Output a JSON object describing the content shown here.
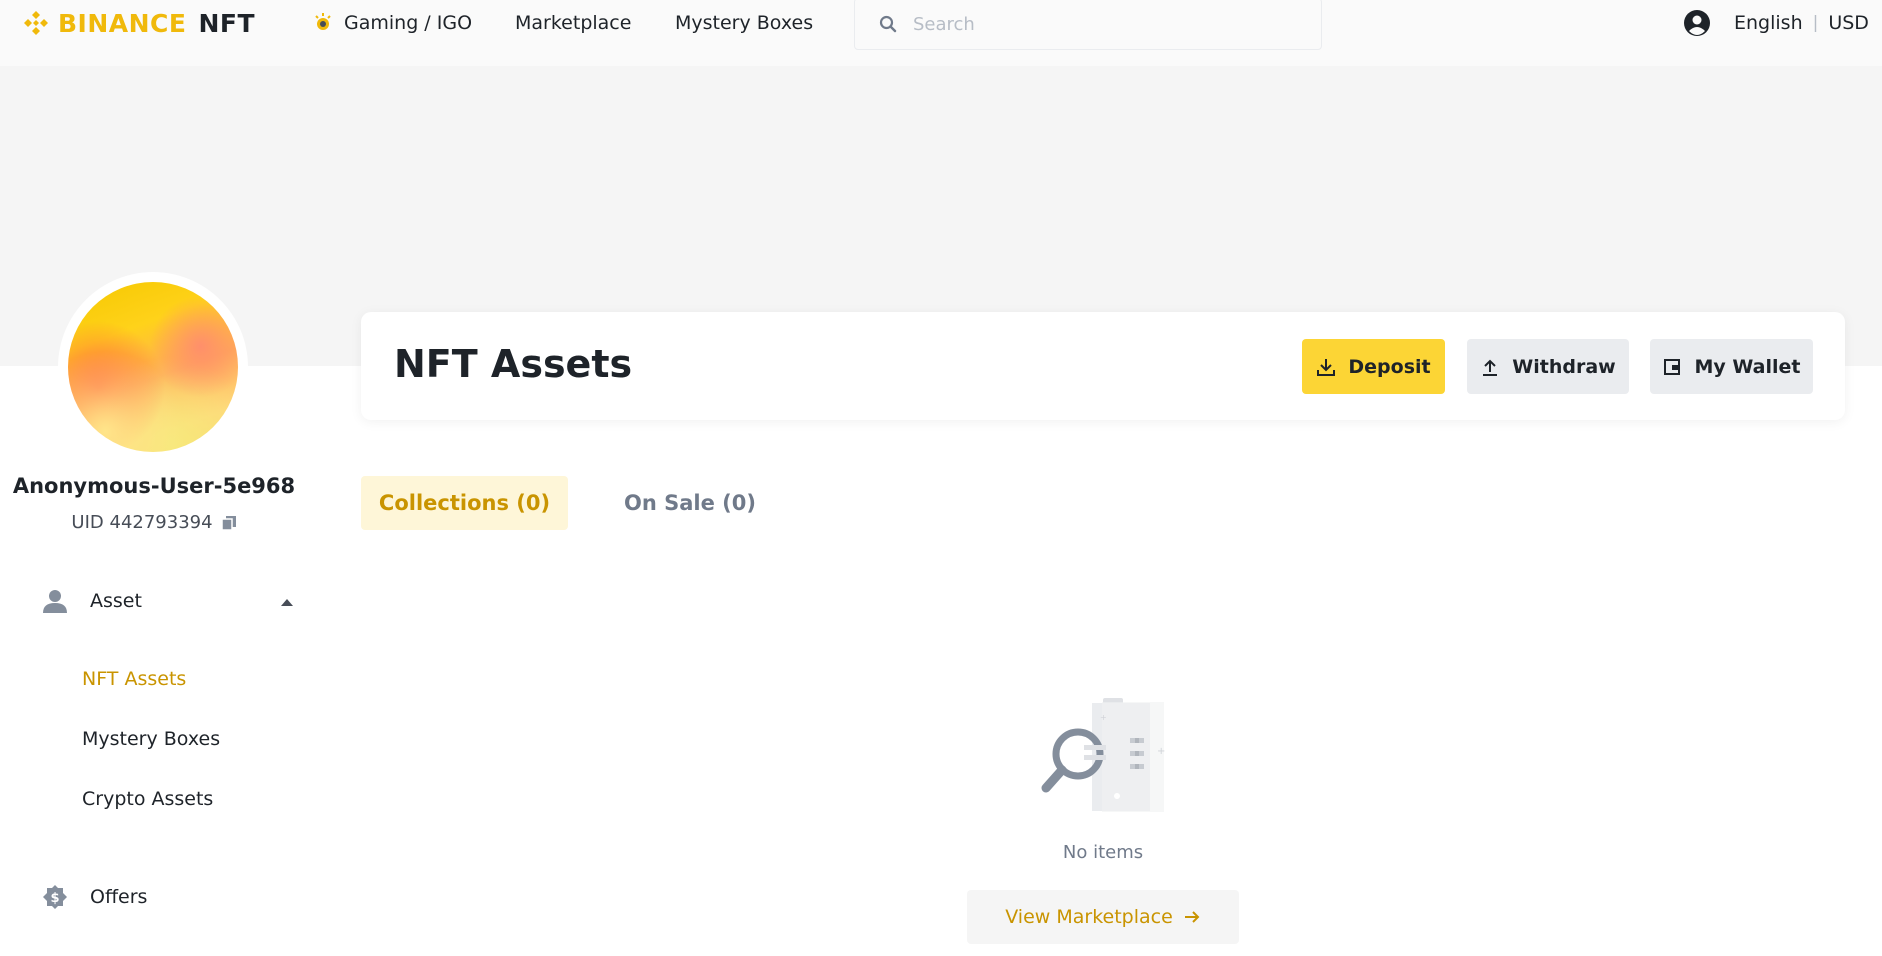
{
  "header": {
    "logo_brand": "BINANCE",
    "logo_product": "NFT",
    "nav": {
      "gaming": "Gaming / IGO",
      "marketplace": "Marketplace",
      "mystery_boxes": "Mystery Boxes"
    },
    "search_placeholder": "Search",
    "language": "English",
    "currency": "USD"
  },
  "profile": {
    "username": "Anonymous-User-5e968",
    "uid": "UID 442793394"
  },
  "sidebar": {
    "asset": "Asset",
    "items": [
      "NFT Assets",
      "Mystery Boxes",
      "Crypto Assets"
    ],
    "offers": "Offers"
  },
  "main": {
    "title": "NFT Assets",
    "buttons": {
      "deposit": "Deposit",
      "withdraw": "Withdraw",
      "my_wallet": "My Wallet"
    },
    "tabs": [
      "Collections (0)",
      "On Sale (0)"
    ],
    "empty_text": "No items",
    "view_marketplace": "View Marketplace"
  },
  "colors": {
    "brand_yellow": "#f0b90b",
    "button_yellow": "#fcd535",
    "active_gold": "#c99400",
    "tab_active_bg": "#fef6d8",
    "banner_bg": "#f5f5f5"
  },
  "icons": [
    "binance-logo-icon",
    "gaming-icon",
    "search-icon",
    "account-icon",
    "user-icon",
    "caret-up-icon",
    "offers-icon",
    "download-icon",
    "upload-icon",
    "wallet-icon",
    "copy-icon",
    "arrow-right-icon",
    "empty-search-illustration"
  ]
}
